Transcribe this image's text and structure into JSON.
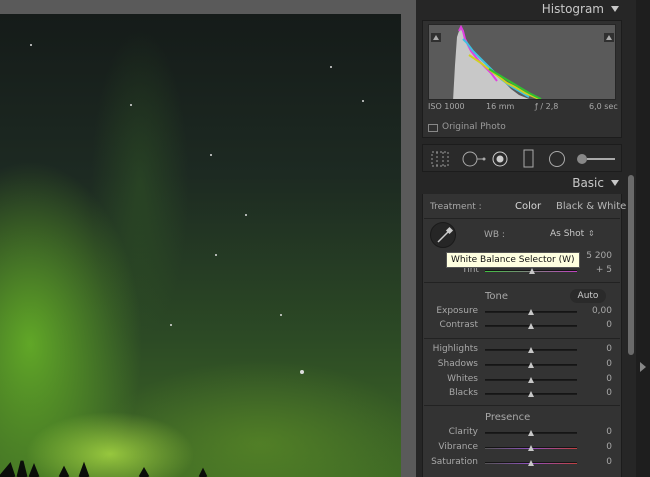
{
  "histogram": {
    "title": "Histogram",
    "iso": "ISO 1000",
    "focal": "16 mm",
    "aperture": "ƒ / 2,8",
    "shutter": "6,0 sec",
    "original_photo": "Original Photo"
  },
  "basic": {
    "title": "Basic",
    "treatment_label": "Treatment :",
    "color": "Color",
    "bw": "Black & White",
    "wb_label": "WB :",
    "wb_value": "As Shot",
    "temp_value": "5 200",
    "tint_label": "Tint",
    "tint_value": "+ 5",
    "tooltip": "White Balance Selector (W)",
    "tone_label": "Tone",
    "auto": "Auto",
    "presence_label": "Presence",
    "sliders": [
      {
        "label": "Exposure",
        "value": "0,00"
      },
      {
        "label": "Contrast",
        "value": "0"
      },
      {
        "label": "Highlights",
        "value": "0"
      },
      {
        "label": "Shadows",
        "value": "0"
      },
      {
        "label": "Whites",
        "value": "0"
      },
      {
        "label": "Blacks",
        "value": "0"
      },
      {
        "label": "Clarity",
        "value": "0"
      },
      {
        "label": "Vibrance",
        "value": "0"
      },
      {
        "label": "Saturation",
        "value": "0"
      }
    ]
  },
  "colors": {
    "panel_bg": "#262626",
    "section_bg": "#333333",
    "tooltip_bg": "#ffffe0"
  },
  "icons": {
    "hist_triangle": "collapse-triangle-icon",
    "crop": "crop-grid-icon",
    "spot": "spot-removal-icon",
    "redeye": "red-eye-icon",
    "grad": "graduated-filter-icon",
    "radial": "radial-filter-icon",
    "brush": "adjustment-brush-icon",
    "eyedropper": "eyedropper-icon"
  }
}
